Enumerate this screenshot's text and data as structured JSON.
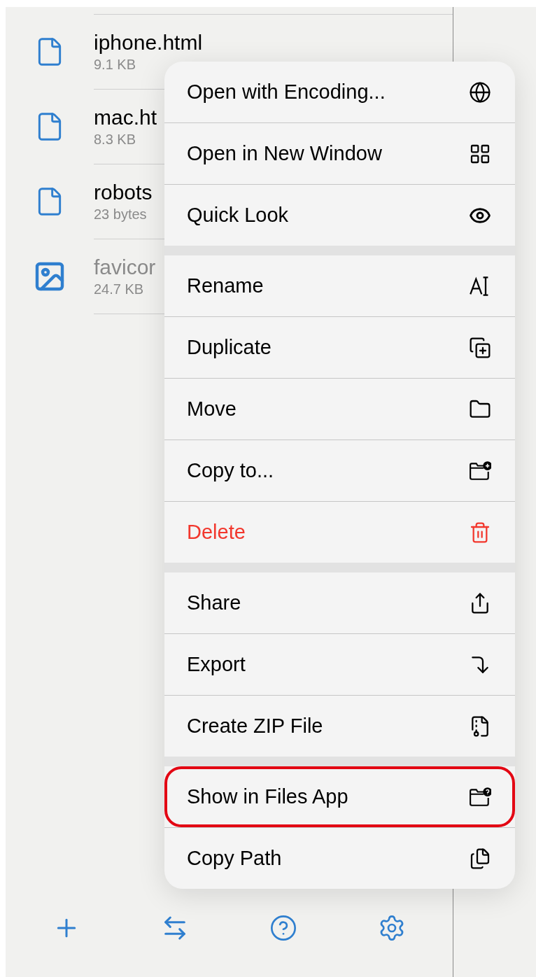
{
  "files": [
    {
      "name": "iphone.html",
      "size": "9.1 KB",
      "kind": "document",
      "dimmed": false
    },
    {
      "name": "mac.ht",
      "size": "8.3 KB",
      "kind": "document",
      "dimmed": false
    },
    {
      "name": "robots",
      "size": "23 bytes",
      "kind": "document",
      "dimmed": false
    },
    {
      "name": "favicor",
      "size": "24.7 KB",
      "kind": "image",
      "dimmed": true
    }
  ],
  "menu": {
    "groups": [
      [
        {
          "label": "Open with Encoding...",
          "destructive": false,
          "highlighted": false
        },
        {
          "label": "Open in New Window",
          "destructive": false,
          "highlighted": false
        },
        {
          "label": "Quick Look",
          "destructive": false,
          "highlighted": false
        }
      ],
      [
        {
          "label": "Rename",
          "destructive": false,
          "highlighted": false
        },
        {
          "label": "Duplicate",
          "destructive": false,
          "highlighted": false
        },
        {
          "label": "Move",
          "destructive": false,
          "highlighted": false
        },
        {
          "label": "Copy to...",
          "destructive": false,
          "highlighted": false
        },
        {
          "label": "Delete",
          "destructive": true,
          "highlighted": false
        }
      ],
      [
        {
          "label": "Share",
          "destructive": false,
          "highlighted": false
        },
        {
          "label": "Export",
          "destructive": false,
          "highlighted": false
        },
        {
          "label": "Create ZIP File",
          "destructive": false,
          "highlighted": false
        }
      ],
      [
        {
          "label": "Show in Files App",
          "destructive": false,
          "highlighted": true
        },
        {
          "label": "Copy Path",
          "destructive": false,
          "highlighted": false
        }
      ]
    ]
  }
}
